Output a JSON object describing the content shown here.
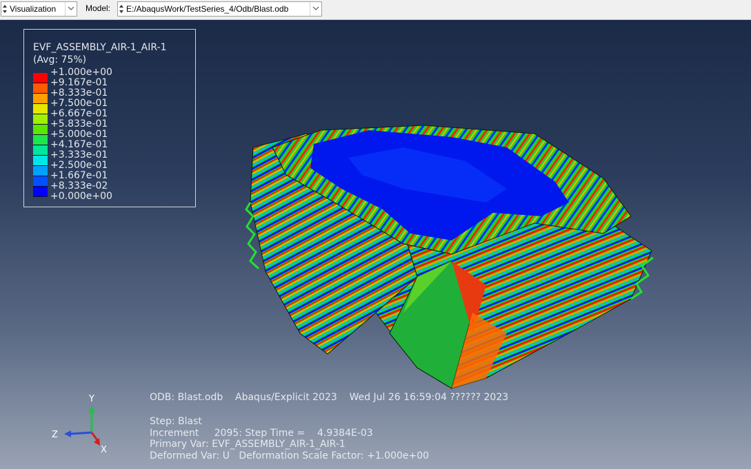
{
  "toolbar": {
    "module": "Visualization",
    "model_label": "Model:",
    "model_path": "E:/AbaqusWork/TestSeries_4/Odb/Blast.odb"
  },
  "legend": {
    "title": "EVF_ASSEMBLY_AIR-1_AIR-1",
    "subtitle": "(Avg: 75%)",
    "levels": [
      "+1.000e+00",
      "+9.167e-01",
      "+8.333e-01",
      "+7.500e-01",
      "+6.667e-01",
      "+5.833e-01",
      "+5.000e-01",
      "+4.167e-01",
      "+3.333e-01",
      "+2.500e-01",
      "+1.667e-01",
      "+8.333e-02",
      "+0.000e+00"
    ],
    "colors": [
      "#ff0000",
      "#ff5a00",
      "#ffa000",
      "#e6e600",
      "#a0f000",
      "#5ae600",
      "#1ee64b",
      "#00e69a",
      "#00e6e6",
      "#00a0ff",
      "#0050ff",
      "#0000ff"
    ]
  },
  "info": {
    "odb_line": "ODB: Blast.odb    Abaqus/Explicit 2023    Wed Jul 26 16:59:04 ?????? 2023",
    "step_line": "Step: Blast",
    "increment_line": "Increment     2095: Step Time =    4.9384E-03",
    "primary_var_line": "Primary Var: EVF_ASSEMBLY_AIR-1_AIR-1",
    "deformed_var_line": "Deformed Var: U   Deformation Scale Factor: +1.000e+00"
  },
  "triad": {
    "x_label": "X",
    "y_label": "Y",
    "z_label": "Z"
  },
  "colors": {
    "viewport_top": "#1a2a47",
    "viewport_bottom": "#9aa3b4",
    "legend_text": "#e6e9ef"
  }
}
